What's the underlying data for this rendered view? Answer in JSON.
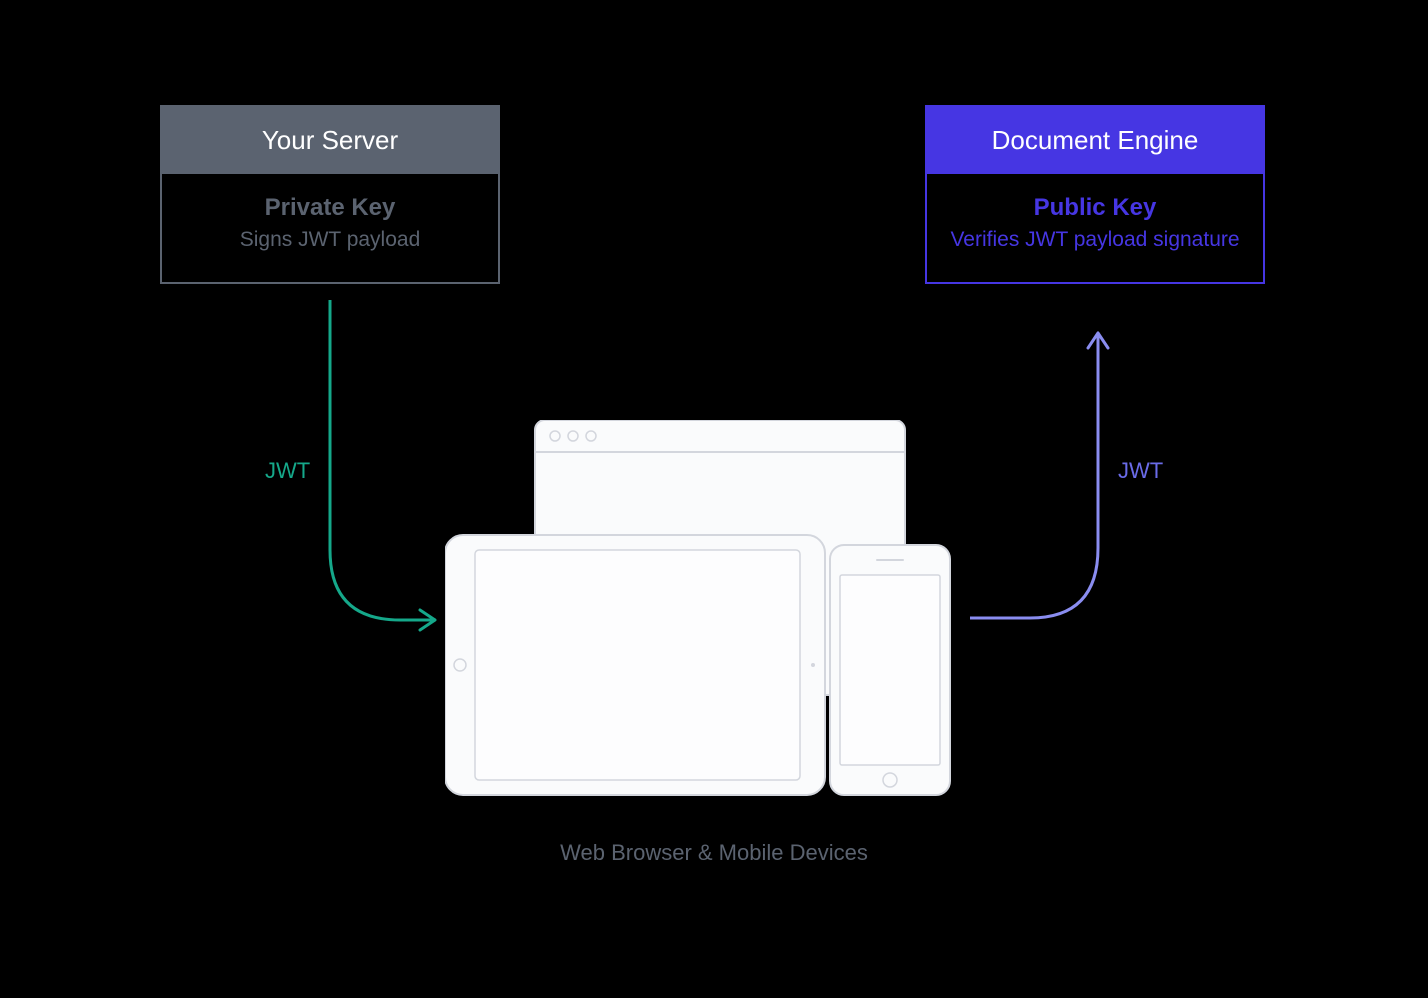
{
  "left_box": {
    "title": "Your Server",
    "key_title": "Private Key",
    "key_desc": "Signs JWT payload"
  },
  "right_box": {
    "title": "Document Engine",
    "key_title": "Public Key",
    "key_desc": "Verifies JWT payload signature"
  },
  "arrows": {
    "left_label": "JWT",
    "right_label": "JWT"
  },
  "caption": "Web Browser & Mobile Devices",
  "colors": {
    "dark_gray": "#5b6370",
    "purple": "#4636e3",
    "teal": "#15a88a",
    "lavender": "#8a8df0",
    "device_outline": "#d3d6dd"
  }
}
